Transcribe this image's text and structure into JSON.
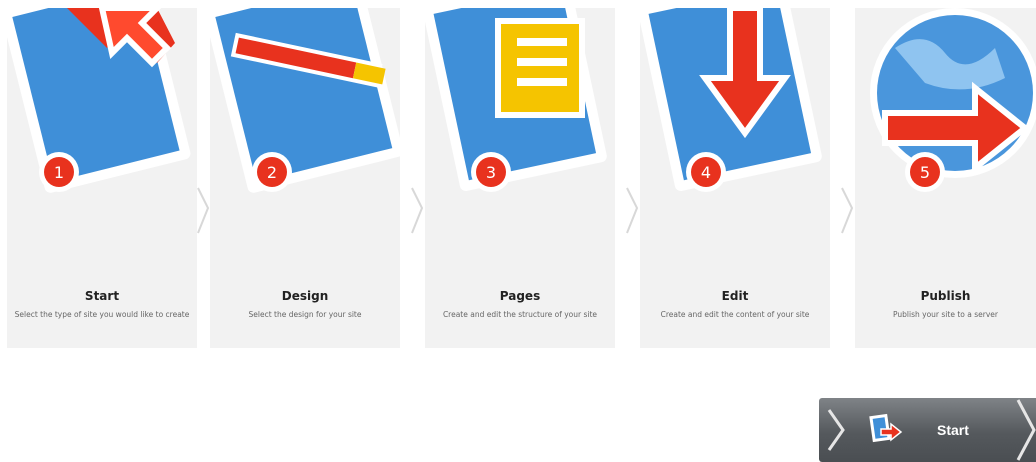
{
  "steps": [
    {
      "number": "1",
      "title": "Start",
      "description": "Select the type of site you would like to create",
      "icon": "arrow-cursor-icon"
    },
    {
      "number": "2",
      "title": "Design",
      "description": "Select the design for your site",
      "icon": "pencil-icon"
    },
    {
      "number": "3",
      "title": "Pages",
      "description": "Create and edit the structure of your site",
      "icon": "pages-icon"
    },
    {
      "number": "4",
      "title": "Edit",
      "description": "Create and edit the content of your site",
      "icon": "down-arrow-icon"
    },
    {
      "number": "5",
      "title": "Publish",
      "description": "Publish your site to a server",
      "icon": "globe-arrow-icon"
    }
  ],
  "start_button": {
    "label": "Start",
    "icon": "document-arrow-icon"
  },
  "colors": {
    "card_bg": "#f2f2f2",
    "blue": "#3f8fd8",
    "red": "#e8321e",
    "yellow": "#f5c400",
    "button_bg": "#5a5e62"
  }
}
